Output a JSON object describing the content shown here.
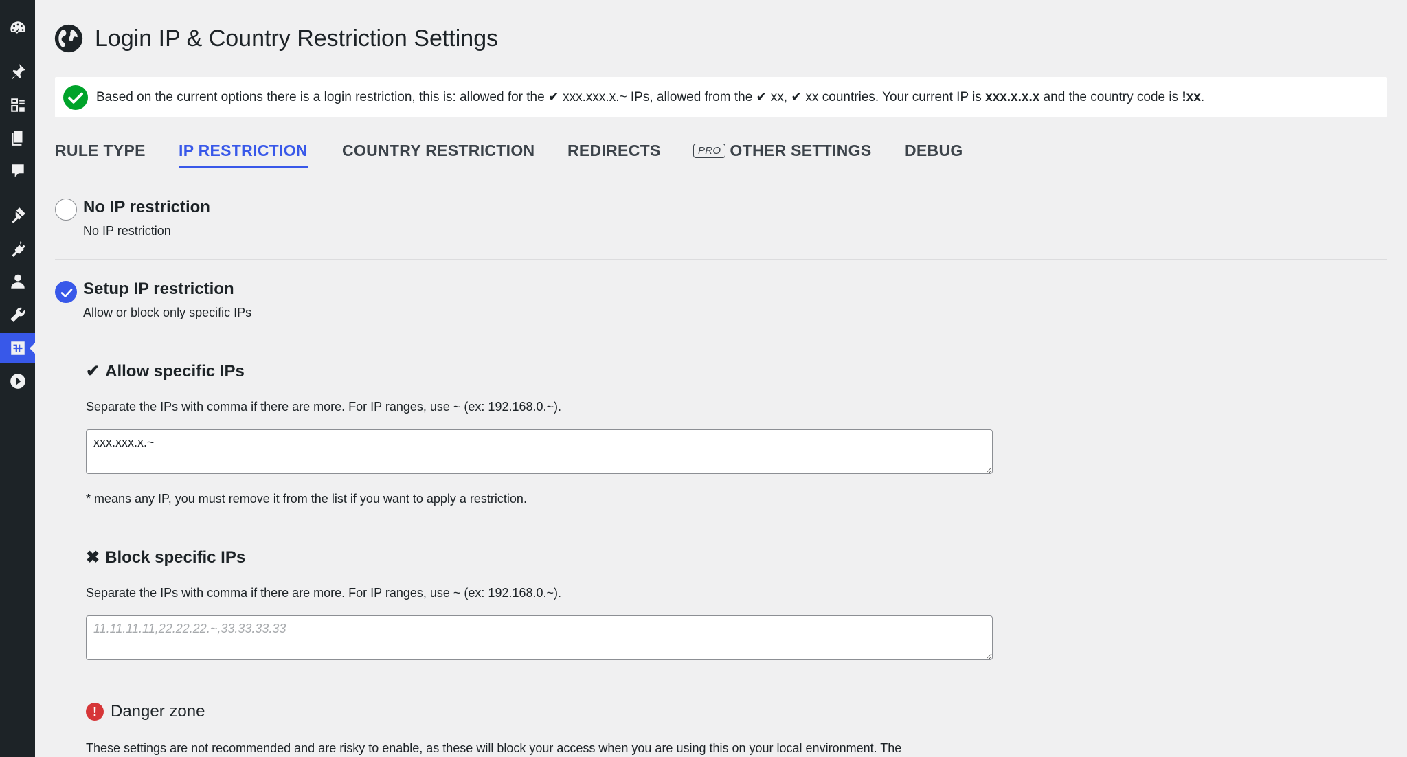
{
  "page": {
    "title": "Login IP & Country Restriction Settings"
  },
  "notice": {
    "part1": "Based on the current options there is a login restriction, this is: allowed for the ✔ xxx.xxx.x.~ IPs, allowed from the ✔ xx, ✔ xx countries. Your current IP is ",
    "ip": "xxx.x.x.x",
    "part2": " and the country code is ",
    "country": "!xx",
    "part3": "."
  },
  "tabs": [
    {
      "label": "RULE TYPE"
    },
    {
      "label": "IP RESTRICTION"
    },
    {
      "label": "COUNTRY RESTRICTION"
    },
    {
      "label": "REDIRECTS"
    },
    {
      "badge": "PRO",
      "label": "OTHER SETTINGS"
    },
    {
      "label": "DEBUG"
    }
  ],
  "options": {
    "no_ip": {
      "title": "No IP restriction",
      "desc": "No IP restriction"
    },
    "setup_ip": {
      "title": "Setup IP restriction",
      "desc": "Allow or block only specific IPs"
    }
  },
  "allow": {
    "glyph": "✔",
    "title": "Allow specific IPs",
    "help": "Separate the IPs with comma if there are more. For IP ranges, use ~ (ex: 192.168.0.~).",
    "value": "xxx.xxx.x.~",
    "note": "* means any IP, you must remove it from the list if you want to apply a restriction."
  },
  "block": {
    "glyph": "✖",
    "title": "Block specific IPs",
    "help": "Separate the IPs with comma if there are more. For IP ranges, use ~ (ex: 192.168.0.~).",
    "placeholder": "11.11.11.11,22.22.22.~,33.33.33.33"
  },
  "danger": {
    "icon": "!",
    "title": "Danger zone",
    "text": "These settings are not recommended and are risky to enable, as these will block your access when you are using this on your local environment. The"
  },
  "colors": {
    "accent": "#3858e9",
    "success": "#00a32a",
    "danger": "#d63638"
  }
}
